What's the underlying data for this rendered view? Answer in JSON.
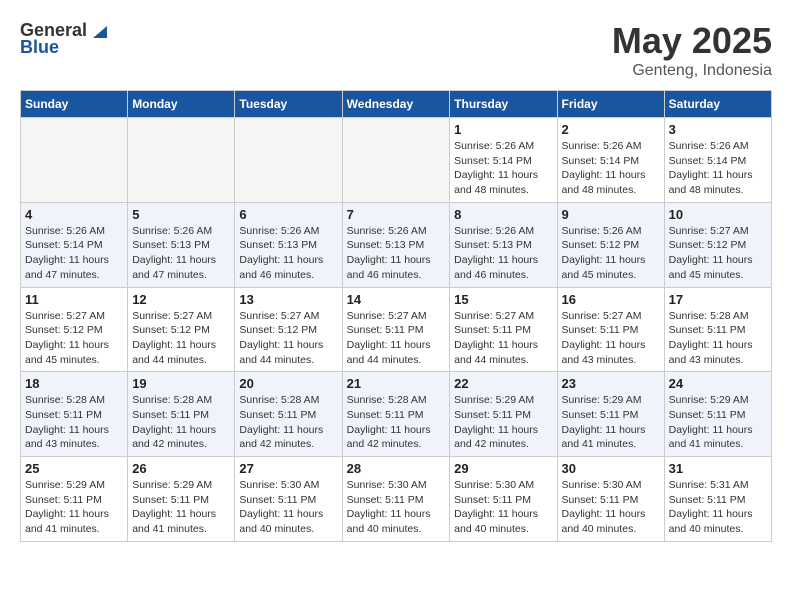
{
  "header": {
    "logo_general": "General",
    "logo_blue": "Blue",
    "title": "May 2025",
    "location": "Genteng, Indonesia"
  },
  "days_of_week": [
    "Sunday",
    "Monday",
    "Tuesday",
    "Wednesday",
    "Thursday",
    "Friday",
    "Saturday"
  ],
  "weeks": [
    [
      {
        "day": "",
        "detail": ""
      },
      {
        "day": "",
        "detail": ""
      },
      {
        "day": "",
        "detail": ""
      },
      {
        "day": "",
        "detail": ""
      },
      {
        "day": "1",
        "detail": "Sunrise: 5:26 AM\nSunset: 5:14 PM\nDaylight: 11 hours\nand 48 minutes."
      },
      {
        "day": "2",
        "detail": "Sunrise: 5:26 AM\nSunset: 5:14 PM\nDaylight: 11 hours\nand 48 minutes."
      },
      {
        "day": "3",
        "detail": "Sunrise: 5:26 AM\nSunset: 5:14 PM\nDaylight: 11 hours\nand 48 minutes."
      }
    ],
    [
      {
        "day": "4",
        "detail": "Sunrise: 5:26 AM\nSunset: 5:14 PM\nDaylight: 11 hours\nand 47 minutes."
      },
      {
        "day": "5",
        "detail": "Sunrise: 5:26 AM\nSunset: 5:13 PM\nDaylight: 11 hours\nand 47 minutes."
      },
      {
        "day": "6",
        "detail": "Sunrise: 5:26 AM\nSunset: 5:13 PM\nDaylight: 11 hours\nand 46 minutes."
      },
      {
        "day": "7",
        "detail": "Sunrise: 5:26 AM\nSunset: 5:13 PM\nDaylight: 11 hours\nand 46 minutes."
      },
      {
        "day": "8",
        "detail": "Sunrise: 5:26 AM\nSunset: 5:13 PM\nDaylight: 11 hours\nand 46 minutes."
      },
      {
        "day": "9",
        "detail": "Sunrise: 5:26 AM\nSunset: 5:12 PM\nDaylight: 11 hours\nand 45 minutes."
      },
      {
        "day": "10",
        "detail": "Sunrise: 5:27 AM\nSunset: 5:12 PM\nDaylight: 11 hours\nand 45 minutes."
      }
    ],
    [
      {
        "day": "11",
        "detail": "Sunrise: 5:27 AM\nSunset: 5:12 PM\nDaylight: 11 hours\nand 45 minutes."
      },
      {
        "day": "12",
        "detail": "Sunrise: 5:27 AM\nSunset: 5:12 PM\nDaylight: 11 hours\nand 44 minutes."
      },
      {
        "day": "13",
        "detail": "Sunrise: 5:27 AM\nSunset: 5:12 PM\nDaylight: 11 hours\nand 44 minutes."
      },
      {
        "day": "14",
        "detail": "Sunrise: 5:27 AM\nSunset: 5:11 PM\nDaylight: 11 hours\nand 44 minutes."
      },
      {
        "day": "15",
        "detail": "Sunrise: 5:27 AM\nSunset: 5:11 PM\nDaylight: 11 hours\nand 44 minutes."
      },
      {
        "day": "16",
        "detail": "Sunrise: 5:27 AM\nSunset: 5:11 PM\nDaylight: 11 hours\nand 43 minutes."
      },
      {
        "day": "17",
        "detail": "Sunrise: 5:28 AM\nSunset: 5:11 PM\nDaylight: 11 hours\nand 43 minutes."
      }
    ],
    [
      {
        "day": "18",
        "detail": "Sunrise: 5:28 AM\nSunset: 5:11 PM\nDaylight: 11 hours\nand 43 minutes."
      },
      {
        "day": "19",
        "detail": "Sunrise: 5:28 AM\nSunset: 5:11 PM\nDaylight: 11 hours\nand 42 minutes."
      },
      {
        "day": "20",
        "detail": "Sunrise: 5:28 AM\nSunset: 5:11 PM\nDaylight: 11 hours\nand 42 minutes."
      },
      {
        "day": "21",
        "detail": "Sunrise: 5:28 AM\nSunset: 5:11 PM\nDaylight: 11 hours\nand 42 minutes."
      },
      {
        "day": "22",
        "detail": "Sunrise: 5:29 AM\nSunset: 5:11 PM\nDaylight: 11 hours\nand 42 minutes."
      },
      {
        "day": "23",
        "detail": "Sunrise: 5:29 AM\nSunset: 5:11 PM\nDaylight: 11 hours\nand 41 minutes."
      },
      {
        "day": "24",
        "detail": "Sunrise: 5:29 AM\nSunset: 5:11 PM\nDaylight: 11 hours\nand 41 minutes."
      }
    ],
    [
      {
        "day": "25",
        "detail": "Sunrise: 5:29 AM\nSunset: 5:11 PM\nDaylight: 11 hours\nand 41 minutes."
      },
      {
        "day": "26",
        "detail": "Sunrise: 5:29 AM\nSunset: 5:11 PM\nDaylight: 11 hours\nand 41 minutes."
      },
      {
        "day": "27",
        "detail": "Sunrise: 5:30 AM\nSunset: 5:11 PM\nDaylight: 11 hours\nand 40 minutes."
      },
      {
        "day": "28",
        "detail": "Sunrise: 5:30 AM\nSunset: 5:11 PM\nDaylight: 11 hours\nand 40 minutes."
      },
      {
        "day": "29",
        "detail": "Sunrise: 5:30 AM\nSunset: 5:11 PM\nDaylight: 11 hours\nand 40 minutes."
      },
      {
        "day": "30",
        "detail": "Sunrise: 5:30 AM\nSunset: 5:11 PM\nDaylight: 11 hours\nand 40 minutes."
      },
      {
        "day": "31",
        "detail": "Sunrise: 5:31 AM\nSunset: 5:11 PM\nDaylight: 11 hours\nand 40 minutes."
      }
    ]
  ]
}
